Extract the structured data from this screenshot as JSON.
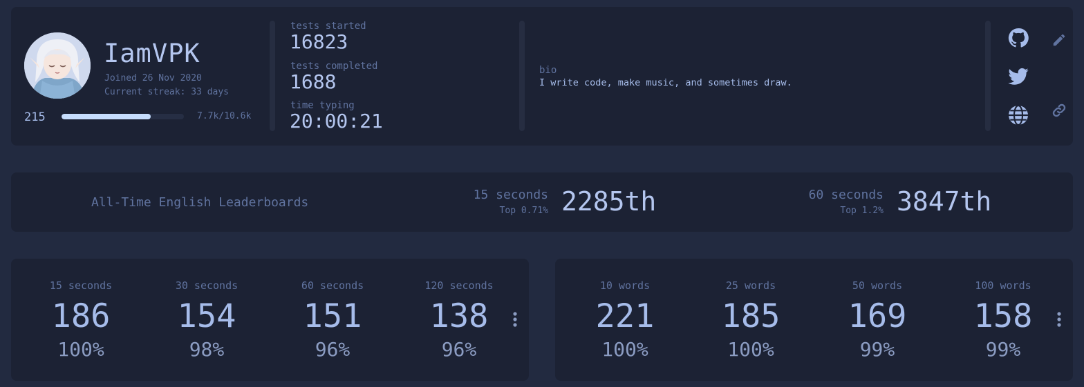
{
  "profile": {
    "username": "IamVPK",
    "joined": "Joined 26 Nov 2020",
    "streak": "Current streak: 33 days",
    "level": "215",
    "xp_text": "7.7k/10.6k",
    "xp_progress": 0.73,
    "stats": [
      {
        "label": "tests started",
        "value": "16823"
      },
      {
        "label": "tests completed",
        "value": "1688"
      },
      {
        "label": "time typing",
        "value": "20:00:21"
      }
    ],
    "bio_label": "bio",
    "bio": "I write code, make music, and sometimes draw.",
    "social_icons": [
      "github-icon",
      "twitter-icon",
      "globe-icon"
    ],
    "action_icons": [
      "pencil-icon",
      "link-icon"
    ]
  },
  "leaderboards": {
    "title": "All-Time English Leaderboards",
    "entries": [
      {
        "mode": "15 seconds",
        "top": "Top 0.71%",
        "rank": "2285th"
      },
      {
        "mode": "60 seconds",
        "top": "Top 1.2%",
        "rank": "3847th"
      }
    ]
  },
  "personal_bests": {
    "time": [
      {
        "mode": "15 seconds",
        "wpm": "186",
        "acc": "100%"
      },
      {
        "mode": "30 seconds",
        "wpm": "154",
        "acc": "98%"
      },
      {
        "mode": "60 seconds",
        "wpm": "151",
        "acc": "96%"
      },
      {
        "mode": "120 seconds",
        "wpm": "138",
        "acc": "96%"
      }
    ],
    "words": [
      {
        "mode": "10 words",
        "wpm": "221",
        "acc": "100%"
      },
      {
        "mode": "25 words",
        "wpm": "185",
        "acc": "100%"
      },
      {
        "mode": "50 words",
        "wpm": "169",
        "acc": "99%"
      },
      {
        "mode": "100 words",
        "wpm": "158",
        "acc": "99%"
      }
    ]
  },
  "colors": {
    "background": "#222a40",
    "card": "#1c2234",
    "text": "#b4c6ef",
    "sub": "#60739f",
    "xp_fill": "#c6ddfd"
  }
}
